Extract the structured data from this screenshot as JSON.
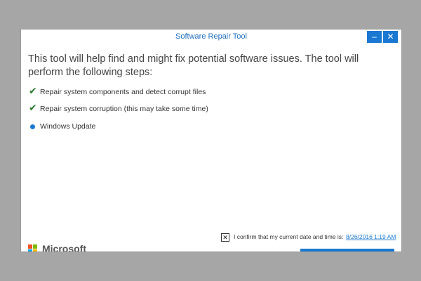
{
  "window": {
    "title": "Software Repair Tool",
    "minimize_glyph": "–",
    "close_glyph": "✕"
  },
  "main": {
    "intro": "This tool will help find and might fix potential software issues. The tool will perform the following steps:",
    "steps": [
      {
        "status": "done",
        "icon": "check-icon",
        "label": "Repair system components and detect corrupt files"
      },
      {
        "status": "done",
        "icon": "check-icon",
        "label": "Repair system corruption (this may take some time)"
      },
      {
        "status": "in-progress",
        "icon": "dot-icon",
        "label": "Windows Update"
      }
    ]
  },
  "footer": {
    "confirm_checkbox_glyph": "✕",
    "confirm_label": "I confirm that my current date and time is:",
    "datetime_link": "8/26/2016 1:19 AM",
    "logo_text": "Microsoft"
  },
  "colors": {
    "accent": "#1a78d2",
    "check": "#2e7d32",
    "logo_red": "#f25022",
    "logo_green": "#7fba00",
    "logo_blue": "#00a4ef",
    "logo_yellow": "#ffb900"
  }
}
